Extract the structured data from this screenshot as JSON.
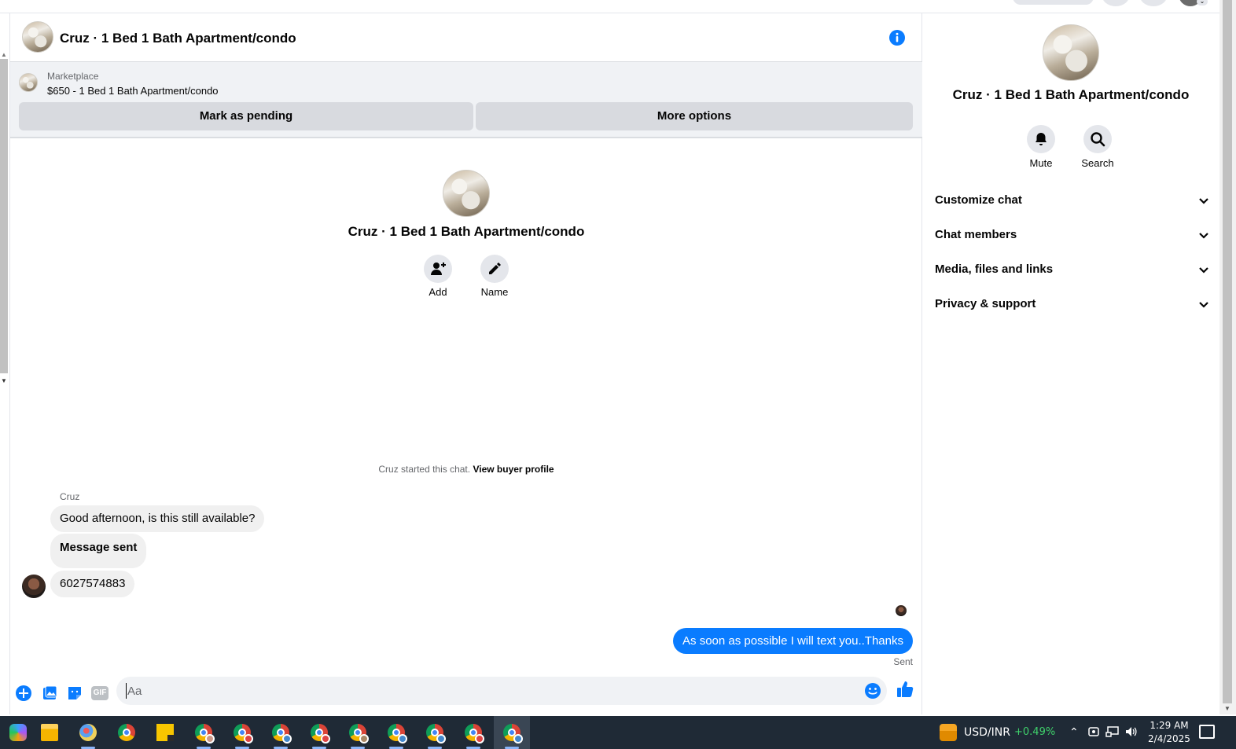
{
  "header": {
    "title": "Cruz · 1 Bed 1 Bath Apartment/condo"
  },
  "marketplace": {
    "label": "Marketplace",
    "listing": "$650 - 1 Bed 1 Bath Apartment/condo",
    "mark_pending_label": "Mark as pending",
    "more_options_label": "More options"
  },
  "conversation": {
    "title": "Cruz · 1 Bed 1 Bath Apartment/condo",
    "add_label": "Add",
    "name_label": "Name",
    "started_text": "Cruz started this chat.",
    "view_profile_label": "View buyer profile"
  },
  "messages": {
    "sender": "Cruz",
    "incoming": [
      "Good afternoon, is this still available?",
      "Message sent",
      "6027574883"
    ],
    "outgoing": "As soon as possible I will text you..Thanks",
    "status": "Sent"
  },
  "composer": {
    "placeholder": "Aa",
    "gif_label": "GIF"
  },
  "side_panel": {
    "title": "Cruz · 1 Bed 1 Bath Apartment/condo",
    "mute_label": "Mute",
    "search_label": "Search",
    "sections": [
      "Customize chat",
      "Chat members",
      "Media, files and links",
      "Privacy & support"
    ]
  },
  "taskbar": {
    "stock_pair": "USD/INR",
    "stock_change": "+0.49%",
    "time": "1:29 AM",
    "date": "2/4/2025"
  },
  "colors": {
    "accent": "#0a7cff",
    "bubble_in": "#f0f0f0",
    "taskbar": "#1f2a36",
    "positive": "#3fd16b"
  }
}
